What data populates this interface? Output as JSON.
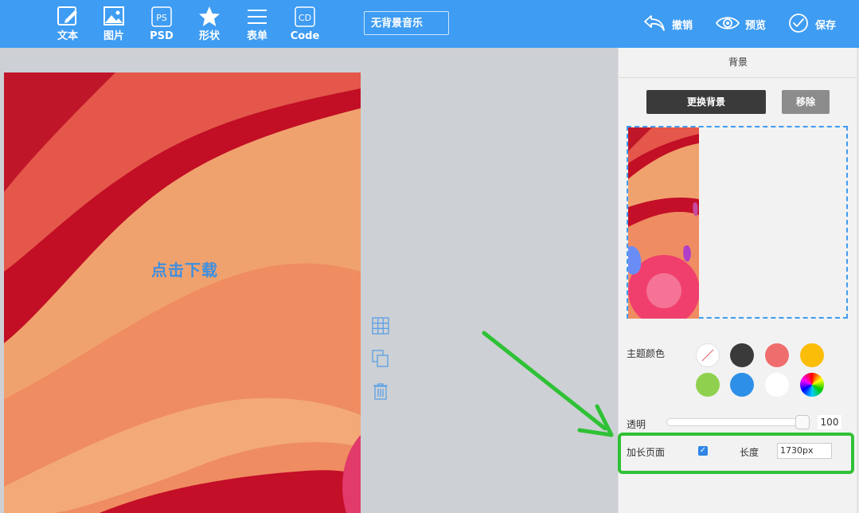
{
  "toolbar": {
    "tools": [
      {
        "label": "文本",
        "icon": "edit-text-icon"
      },
      {
        "label": "图片",
        "icon": "image-icon"
      },
      {
        "label": "PSD",
        "icon": "psd-icon",
        "icon_text": "PS"
      },
      {
        "label": "形状",
        "icon": "star-shape-icon"
      },
      {
        "label": "表单",
        "icon": "form-list-icon"
      },
      {
        "label": "Code",
        "icon": "code-icon",
        "icon_text": "CD"
      }
    ],
    "music_selector": "无背景音乐",
    "undo_label": "撤销",
    "preview_label": "预览",
    "save_label": "保存"
  },
  "canvas": {
    "text": "点击下载"
  },
  "panel": {
    "title": "背景",
    "change_bg_label": "更换背景",
    "remove_label": "移除",
    "theme_color_label": "主题颜色",
    "theme_colors": [
      "none",
      "#3a3a3a",
      "#f06d6d",
      "#fbbd08",
      "#8fd14f",
      "#2d8fe8",
      "#ffffff",
      "rainbow"
    ],
    "opacity_label": "透明",
    "opacity_value": "100",
    "long_page_label": "加长页面",
    "long_page_checked": true,
    "length_label": "长度",
    "length_value": "1730px"
  },
  "colors": {
    "brand": "#3e9cf2",
    "highlight": "#2fc136"
  }
}
